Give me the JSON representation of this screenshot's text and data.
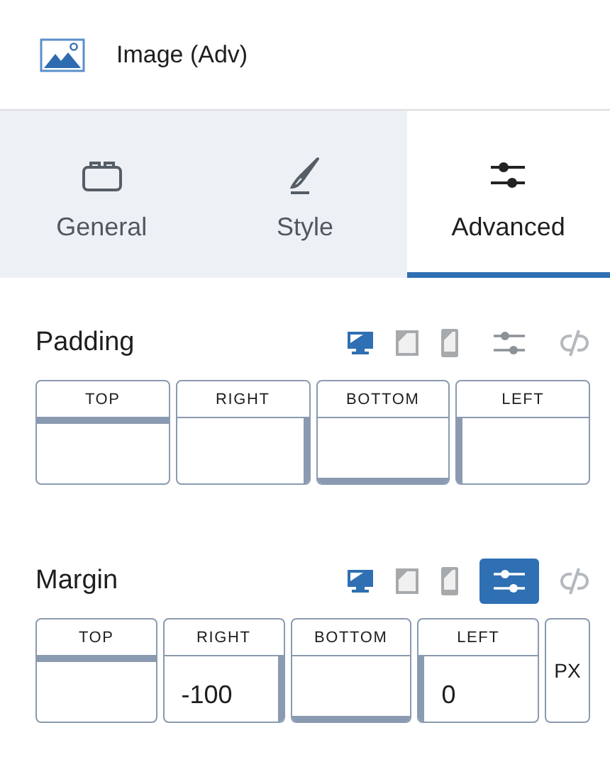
{
  "header": {
    "title": "Image (Adv)"
  },
  "tabs": [
    {
      "label": "General",
      "kind": "general",
      "selected": false
    },
    {
      "label": "Style",
      "kind": "style",
      "selected": false
    },
    {
      "label": "Advanced",
      "kind": "advanced",
      "selected": true
    }
  ],
  "sections": [
    {
      "title": "Padding",
      "devices": [
        {
          "kind": "desktop",
          "selected": true
        },
        {
          "kind": "tablet",
          "selected": false
        },
        {
          "kind": "mobile",
          "selected": false
        }
      ],
      "custom_units": false,
      "linked": false,
      "sides": [
        {
          "label": "TOP"
        },
        {
          "label": "RIGHT"
        },
        {
          "label": "BOTTOM"
        },
        {
          "label": "LEFT"
        }
      ]
    },
    {
      "title": "Margin",
      "devices": [
        {
          "kind": "desktop",
          "selected": true
        },
        {
          "kind": "tablet",
          "selected": false
        },
        {
          "kind": "mobile",
          "selected": false
        }
      ],
      "custom_units": true,
      "linked": false,
      "sides": [
        {
          "label": "TOP"
        },
        {
          "label": "RIGHT",
          "value": "-100"
        },
        {
          "label": "BOTTOM"
        },
        {
          "label": "LEFT",
          "value": "0"
        }
      ],
      "unit": "PX"
    }
  ]
}
